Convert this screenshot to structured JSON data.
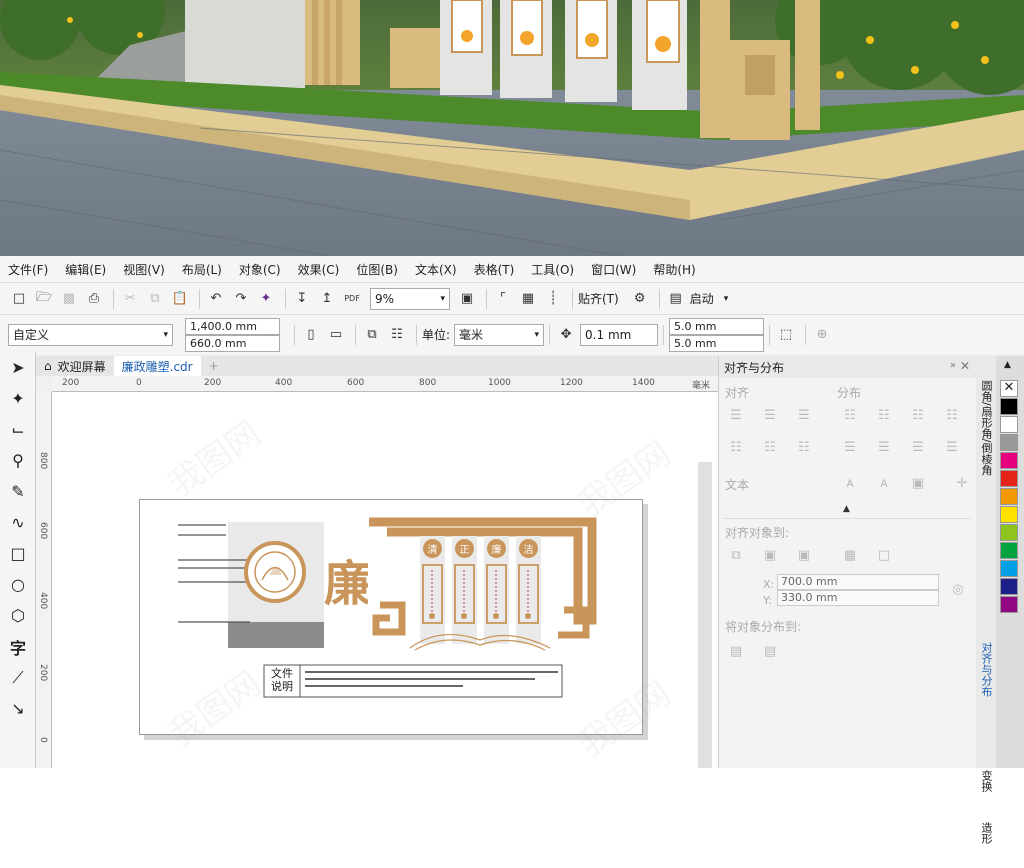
{
  "menu": [
    "文件(F)",
    "编辑(E)",
    "视图(V)",
    "布局(L)",
    "对象(C)",
    "效果(C)",
    "位图(B)",
    "文本(X)",
    "表格(T)",
    "工具(O)",
    "窗口(W)",
    "帮助(H)"
  ],
  "toolbar1": {
    "zoom": "9%",
    "snap_label": "贴齐(T)",
    "launch_label": "启动",
    "pdf_label": "PDF"
  },
  "toolbar2": {
    "preset": "自定义",
    "width": "1,400.0 mm",
    "height": "660.0 mm",
    "unit_label": "单位:",
    "unit_value": "毫米",
    "nudge": "0.1 mm",
    "dup_x": "5.0 mm",
    "dup_y": "5.0 mm"
  },
  "tabs": {
    "welcome": "欢迎屏幕",
    "file": "廉政雕塑.cdr"
  },
  "ruler": {
    "h_ticks": [
      "200",
      "0",
      "200",
      "400",
      "600",
      "800",
      "1000",
      "1200",
      "1400"
    ],
    "h_unit": "毫米",
    "v_ticks": [
      "800",
      "600",
      "400",
      "200",
      "0"
    ]
  },
  "design": {
    "main_char": "廉",
    "circle_chars": [
      "清",
      "正",
      "廉",
      "洁"
    ],
    "note_label_1": "文件",
    "note_label_2": "说明"
  },
  "docker": {
    "title": "对齐与分布",
    "align": "对齐",
    "distribute": "分布",
    "text": "文本",
    "align_to": "对齐对象到:",
    "x_val": "700.0 mm",
    "y_val": "330.0 mm",
    "x_label": "X:",
    "y_label": "Y:",
    "distribute_to": "将对象分布到:"
  },
  "vtabs": [
    "圆角/扇形角/倒棱角",
    "对齐与分布",
    "变换",
    "造形"
  ],
  "palette": [
    "#000000",
    "#ffffff",
    "#999999",
    "#e6007e",
    "#e4241b",
    "#f39800",
    "#ffe100",
    "#8fc31f",
    "#00a33e",
    "#00a0e9",
    "#1d2088",
    "#920783"
  ],
  "watermark": "我图网",
  "colors": {
    "accent": "#c9955a",
    "tab_active": "#1b5fb0"
  }
}
